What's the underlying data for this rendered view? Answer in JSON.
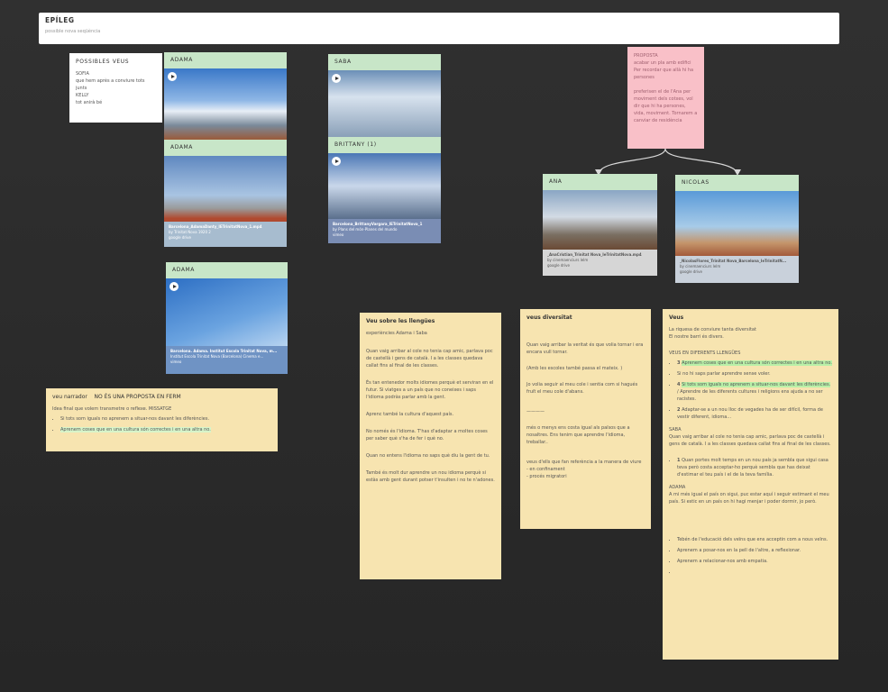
{
  "header": {
    "title": "EPÍLEG",
    "subtitle": "possible nova seqüència"
  },
  "possibles": {
    "title": "POSSIBLES VEUS",
    "lines": [
      "SOFIA",
      "que hem après a conviure tots",
      "junts",
      "KELLY",
      "tot anirà bé"
    ]
  },
  "cards": {
    "adama1": {
      "title": "ADAMA"
    },
    "adama2": {
      "title": "ADAMA",
      "file": "Barcelona_AdamaDanty_IETrinitatNova_1.mp4",
      "by": "by Trinitat Nova 1920 2",
      "source": "google drive"
    },
    "saba": {
      "title": "SABA"
    },
    "brittany": {
      "title": "BRITTANY (1)",
      "file": "Barcelona_BrittanyVargara_IETrinitatNova_1",
      "by": "by Plans del món-Planes del mundo",
      "source": "vimeo"
    },
    "adama3": {
      "title": "ADAMA",
      "file": "Barcelona. Adama. Institut Escola Trinitat Nova, m...",
      "by": "Institut Escola Trinitat Nova (Barcelona) Cinema e...",
      "source": "vimeo"
    },
    "ana": {
      "title": "ANA",
      "file": "_AnaCristian_Trinitat Nova_IeTrinitatNova.mp4",
      "by": "by cinemaenciurs lelm",
      "source": "google drive"
    },
    "nicolas": {
      "title": "NICOLAS",
      "file": "_NicolasFlores_Trinitat Nova_Barcelona_IeTrinitatN...",
      "by": "by cinemaenciurs lelm",
      "source": "google drive"
    }
  },
  "proposta": {
    "lines": [
      "PROPOSTA",
      "acabar un pla amb edifici",
      "Per recordar que allà hi ha",
      "persones"
    ],
    "lines2": [
      "preferisen el de l'Ana per",
      "moviment dels cotxes, vol",
      "dir que hi ha persones,",
      "vida, moviment. Tornarem a",
      "canviar de residència"
    ]
  },
  "narrador": {
    "label": "veu narrador",
    "title": "NO ÉS UNA PROPOSTA EN FERM",
    "subtitle": "Idea final que volem transmetre o reflexe. MISSATGE",
    "items": [
      "Si tots som iguals no aprenem a situar-nos davant les diferències.",
      "Aprenem coses que en una cultura són correctes i en una altra no."
    ]
  },
  "llengues": {
    "title": "Veu sobre les llengües",
    "subtitle": "experiències Adama i Saba",
    "paras": [
      "Quan vaig arribar al cole no tenia cap amic, parlava poc de castellà i gens de català. I a les classes quedava callat fins al final de les classes.",
      "És tan entenedor molts idiomes perquè et serviran en el futur. Si viatges a un país que no coneixes i saps l'idioma podràs parlar amb la gent.",
      "Aprenc també la cultura d'aquest país.",
      "No només és l'idioma. T'has d'adaptar a moltes coses per saber què s'ha de fer i què no.",
      "Quan no entens l'idioma no saps què diu la gent de tu.",
      "També és molt dur aprendre un nou idioma perquè si estàs amb gent durant potser t'insulten i no te n'adones."
    ]
  },
  "diversitat": {
    "title": "veus diversitat",
    "paras": [
      "Quan vaig arribar la veritat és que volia tornar i era encara vull tornar.",
      "(Amb les escoles també passa el mateix. )",
      "Jo volia seguir al meu cole i sentia com si hagués fruït el meu cole d'abans.",
      "————",
      "més o menys ens costa igual als països que a nosaltres. Ens tenim que aprendre l'idioma, treballar..",
      "veus d'ells que fan referència a la manera de viure",
      "- en confinament",
      "- procés migratori"
    ]
  },
  "veus": {
    "title": "Veus",
    "intro1": "La riquesa de conviure tanta diversitat",
    "intro2": "El nostre barri és divers.",
    "section": "VEUS EN DIFERENTS LLENGÜES",
    "b1num": "3",
    "b1": "Aprenem coses que en una cultura són correctes i en una altra no.",
    "b2": "Si no hi saps parlar aprendre sense voler.",
    "b3num": "4",
    "b3": "Si tots som iguals no aprenem a situar-nos davant les diferències.",
    "b3b": "/ Aprendre de les diferents cultures i religions ens ajuda a no ser racistes.",
    "b4num": "2",
    "b4": "Adaptar-se a un nou lloc de vegades ha de ser difícil, forma de vestir diferent, idioma...",
    "saba_label": "SABA",
    "saba_text": "Quan vaig arribar al cole no tenia cap amic, parlava poc de castellà i gens de català. I a les classes quedava callat fins al final de les classes.",
    "b5num": "1",
    "b5": "Quan portes molt temps en un nou país ja sembla que sigui casa teva però costa acceptar-ho perquè sembla que has deixat d'estimar el teu país i el de la teva família.",
    "adama_label": "ADAMA",
    "adama_text": "A mi més igual el país on sigui, puc estar aquí i seguir estimant el meu país. Si estic en un país on hi hagi menjar i poder dormir, jo però.",
    "tail": [
      "Tebén de l'educació dels veïns que ens acceptin com a nous veïns.",
      "Aprenem a posar-nos en la pell de l'altre, a reflexionar.",
      "Aprenem a relacionar-nos amb empatia.",
      ""
    ]
  }
}
